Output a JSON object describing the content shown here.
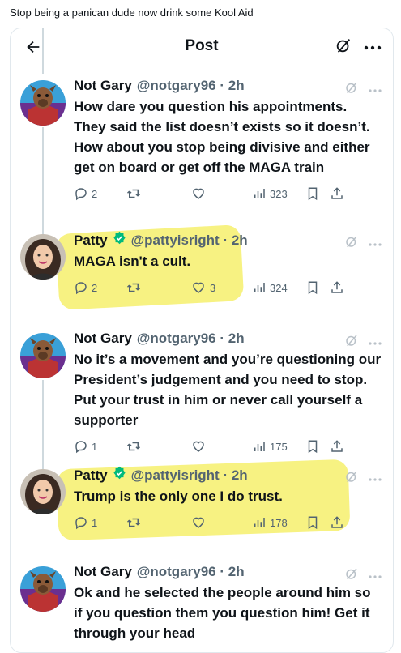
{
  "caption": "Stop being a panican dude now drink some Kool Aid",
  "topbar": {
    "title": "Post"
  },
  "tweets": [
    {
      "name": "Not Gary",
      "handle": "@notgary96",
      "time": "2h",
      "verified": false,
      "text": "How dare you question his appointments. They said the list doesn’t exists so it doesn’t. How about you stop being divisive and either get on board or get off the MAGA train",
      "replies": "2",
      "retweets": "",
      "likes": "",
      "views": "323"
    },
    {
      "name": "Patty",
      "handle": "@pattyisright",
      "time": "2h",
      "verified": true,
      "text": "MAGA isn't a cult.",
      "replies": "2",
      "retweets": "",
      "likes": "3",
      "views": "324"
    },
    {
      "name": "Not Gary",
      "handle": "@notgary96",
      "time": "2h",
      "verified": false,
      "text": "No it’s a movement and you’re questioning our President’s judgement and you need to stop. Put your trust in him or never call yourself a supporter",
      "replies": "1",
      "retweets": "",
      "likes": "",
      "views": "175"
    },
    {
      "name": "Patty",
      "handle": "@pattyisright",
      "time": "2h",
      "verified": true,
      "text": "Trump is the only one I do trust.",
      "replies": "1",
      "retweets": "",
      "likes": "",
      "views": "178"
    },
    {
      "name": "Not Gary",
      "handle": "@notgary96",
      "time": "2h",
      "verified": false,
      "text": "Ok and he selected the people around him so if you question them you question him! Get it through your head",
      "replies": "",
      "retweets": "",
      "likes": "",
      "views": ""
    }
  ],
  "colors": {
    "highlight": "#f6f06c",
    "verified": "#00ba7c",
    "muted": "#536471",
    "grok": "#b9c1c8"
  },
  "icons": [
    "back-arrow-icon",
    "grok-icon",
    "more-icon",
    "reply-icon",
    "retweet-icon",
    "like-icon",
    "views-icon",
    "bookmark-icon",
    "share-icon",
    "verified-badge-icon"
  ]
}
